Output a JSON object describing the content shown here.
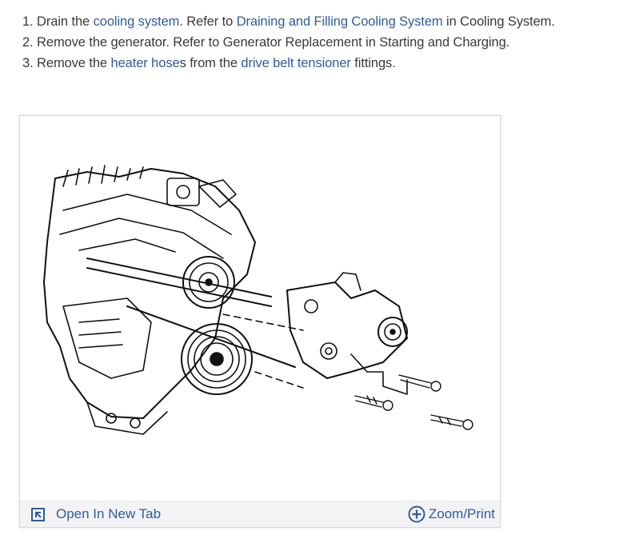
{
  "steps": [
    {
      "num": "1.",
      "p1": "Drain the ",
      "link1": "cooling system",
      "p2": ". Refer to ",
      "link2": "Draining and Filling Cooling System",
      "p3": " in Cooling System."
    },
    {
      "num": "2.",
      "text": "Remove the generator. Refer to Generator Replacement in Starting and Charging."
    },
    {
      "num": "3.",
      "p1": "Remove the ",
      "link1": "heater hose",
      "p2": "s from the ",
      "link2": "drive belt tensioner",
      "p3": " fittings."
    }
  ],
  "figure": {
    "open_tab_label": "Open In New Tab",
    "zoom_label": "Zoom/Print",
    "open_tab_icon": "open-in-new-tab-icon",
    "zoom_icon": "plus-circle-icon"
  },
  "colors": {
    "link": "#2f5d9c",
    "text": "#3a3a3a",
    "footer_bg": "#f3f3f6"
  }
}
